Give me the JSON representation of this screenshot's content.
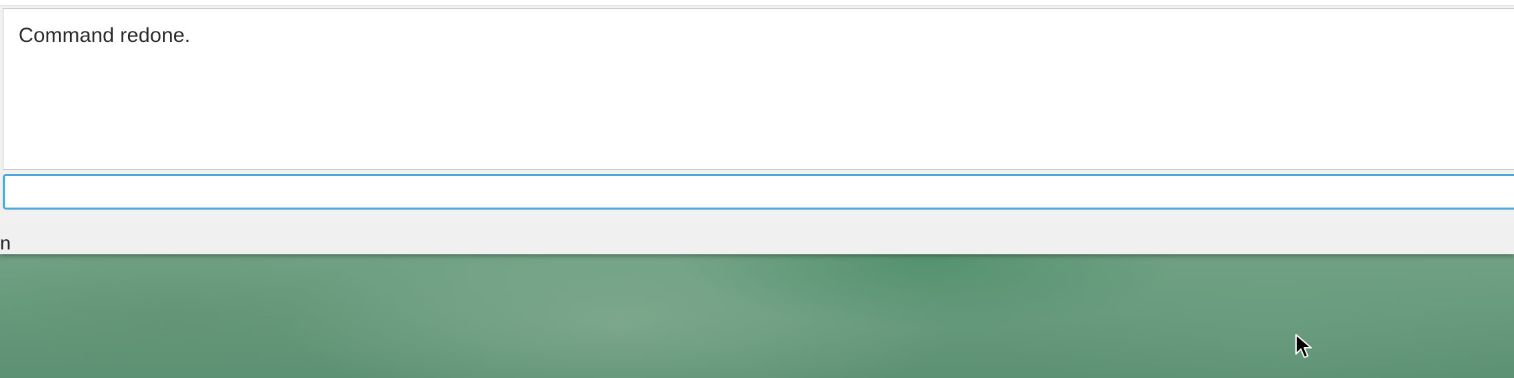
{
  "output": {
    "message": "Command redone."
  },
  "command_box": {
    "value": "",
    "placeholder": ""
  },
  "status_bar": {
    "text": "n"
  },
  "desktop": {
    "icons": [
      "mouse-pointer-icon"
    ]
  }
}
